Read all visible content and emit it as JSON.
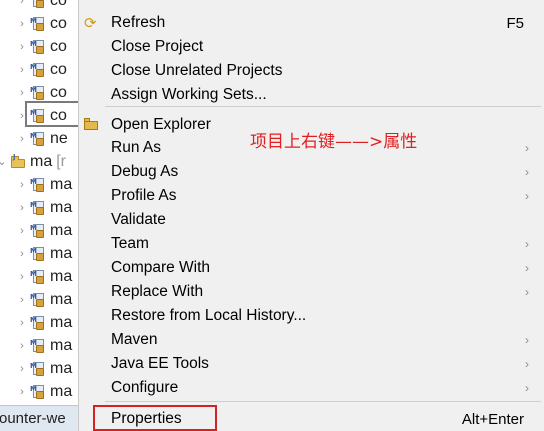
{
  "tree": {
    "rows": [
      {
        "label": "co",
        "expanded": false,
        "type": "maven",
        "grey": false
      },
      {
        "label": "co",
        "expanded": false,
        "type": "maven",
        "grey": false
      },
      {
        "label": "co",
        "expanded": false,
        "type": "maven",
        "grey": false
      },
      {
        "label": "co",
        "expanded": false,
        "type": "maven",
        "grey": false
      },
      {
        "label": "co",
        "expanded": false,
        "type": "maven",
        "grey": false
      },
      {
        "label": "co",
        "expanded": false,
        "type": "maven",
        "grey": false
      },
      {
        "label": "ne",
        "expanded": false,
        "type": "maven",
        "grey": false
      },
      {
        "label": "ma",
        "suffix": "[r",
        "expanded": true,
        "type": "folder",
        "grey": false
      },
      {
        "label": "ma",
        "expanded": false,
        "type": "maven",
        "grey": false
      },
      {
        "label": "ma",
        "expanded": false,
        "type": "maven",
        "grey": false
      },
      {
        "label": "ma",
        "expanded": false,
        "type": "maven",
        "grey": false
      },
      {
        "label": "ma",
        "expanded": false,
        "type": "maven",
        "grey": false
      },
      {
        "label": "ma",
        "expanded": false,
        "type": "maven",
        "grey": false
      },
      {
        "label": "ma",
        "expanded": false,
        "type": "maven",
        "grey": false
      },
      {
        "label": "ma",
        "expanded": false,
        "type": "maven",
        "grey": false
      },
      {
        "label": "ma",
        "expanded": false,
        "type": "maven",
        "grey": false
      },
      {
        "label": "ma",
        "expanded": false,
        "type": "maven",
        "grey": false
      },
      {
        "label": "ma",
        "expanded": false,
        "type": "maven",
        "grey": false
      }
    ],
    "status_tab_label": "ounter-we"
  },
  "menu": {
    "items": [
      {
        "label": "Refresh",
        "shortcut": "F5",
        "submenu": false,
        "icon": "refresh-icon"
      },
      {
        "label": "Close Project",
        "shortcut": "",
        "submenu": false,
        "icon": ""
      },
      {
        "label": "Close Unrelated Projects",
        "shortcut": "",
        "submenu": false,
        "icon": ""
      },
      {
        "label": "Assign Working Sets...",
        "shortcut": "",
        "submenu": false,
        "icon": ""
      },
      {
        "label": "Open Explorer",
        "shortcut": "",
        "submenu": false,
        "icon": "explorer-icon"
      },
      {
        "label": "Run As",
        "shortcut": "",
        "submenu": true,
        "icon": ""
      },
      {
        "label": "Debug As",
        "shortcut": "",
        "submenu": true,
        "icon": ""
      },
      {
        "label": "Profile As",
        "shortcut": "",
        "submenu": true,
        "icon": ""
      },
      {
        "label": "Validate",
        "shortcut": "",
        "submenu": false,
        "icon": ""
      },
      {
        "label": "Team",
        "shortcut": "",
        "submenu": true,
        "icon": ""
      },
      {
        "label": "Compare With",
        "shortcut": "",
        "submenu": true,
        "icon": ""
      },
      {
        "label": "Replace With",
        "shortcut": "",
        "submenu": true,
        "icon": ""
      },
      {
        "label": "Restore from Local History...",
        "shortcut": "",
        "submenu": false,
        "icon": ""
      },
      {
        "label": "Maven",
        "shortcut": "",
        "submenu": true,
        "icon": ""
      },
      {
        "label": "Java EE Tools",
        "shortcut": "",
        "submenu": true,
        "icon": ""
      },
      {
        "label": "Configure",
        "shortcut": "",
        "submenu": true,
        "icon": ""
      },
      {
        "label": "Properties",
        "shortcut": "Alt+Enter",
        "submenu": false,
        "icon": ""
      }
    ],
    "submenu_glyph": "›"
  },
  "annotation": {
    "text": "项目上右键——>属性",
    "color": "#e02020"
  },
  "colors": {
    "menu_bg": "#f0f0f0",
    "highlight_box": "#d22222",
    "selection_box": "#7a7a7a"
  }
}
